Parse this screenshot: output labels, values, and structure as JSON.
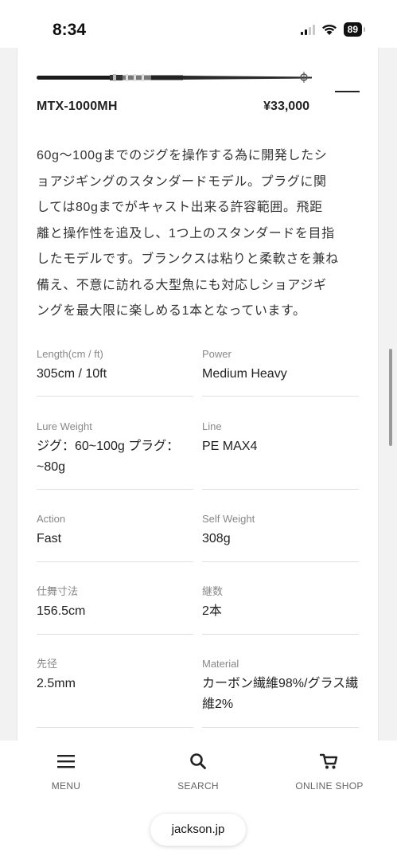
{
  "status_bar": {
    "time": "8:34",
    "battery": "89"
  },
  "product": {
    "model": "MTX-1000MH",
    "price": "¥33,000",
    "description": [
      "60g〜100gまでのジグを操作する為に開発したシ",
      "ョアジギングのスタンダードモデル。プラグに関",
      "しては80gまでがキャスト出来る許容範囲。飛距",
      "離と操作性を追及し、1つ上のスタンダードを目指",
      "したモデルです。ブランクスは粘りと柔軟さを兼ね",
      "備え、不意に訪れる大型魚にも対応しショアジギ",
      "ングを最大限に楽しめる1本となっています。"
    ]
  },
  "specs": [
    {
      "label": "Length(cm / ft)",
      "value": "305cm / 10ft"
    },
    {
      "label": "Power",
      "value": "Medium Heavy"
    },
    {
      "label": "Lure Weight",
      "value": "ジグ：60~100g プラグ：~80g"
    },
    {
      "label": "Line",
      "value": "PE MAX4"
    },
    {
      "label": "Action",
      "value": "Fast"
    },
    {
      "label": "Self Weight",
      "value": "308g"
    },
    {
      "label": "仕舞寸法",
      "value": "156.5cm"
    },
    {
      "label": "継数",
      "value": "2本"
    },
    {
      "label": "先径",
      "value": "2.5mm"
    },
    {
      "label": "Material",
      "value": "カーボン繊維98%/グラス繊維2%"
    }
  ],
  "nav": {
    "menu": {
      "label": "MENU",
      "icon": "hamburger-icon"
    },
    "search": {
      "label": "SEARCH",
      "icon": "search-icon"
    },
    "shop": {
      "label": "ONLINE SHOP",
      "icon": "cart-icon"
    }
  },
  "browser": {
    "url": "jackson.jp"
  }
}
